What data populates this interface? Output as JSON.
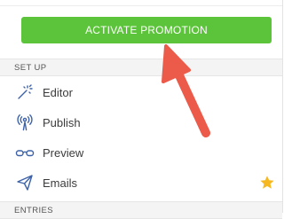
{
  "activate_button": {
    "label": "ACTIVATE PROMOTION"
  },
  "sections": {
    "setup": {
      "title": "SET UP"
    },
    "entries": {
      "title": "ENTRIES"
    }
  },
  "menu": [
    {
      "label": "Editor",
      "icon": "magic-wand-icon"
    },
    {
      "label": "Publish",
      "icon": "broadcast-icon"
    },
    {
      "label": "Preview",
      "icon": "glasses-icon"
    },
    {
      "label": "Emails",
      "icon": "paper-plane-icon",
      "badge": "star-icon"
    }
  ],
  "colors": {
    "button_green": "#5cc43a",
    "icon_blue": "#3d62a8",
    "star_gold": "#f5b820",
    "arrow_red": "#ec5a4a"
  }
}
